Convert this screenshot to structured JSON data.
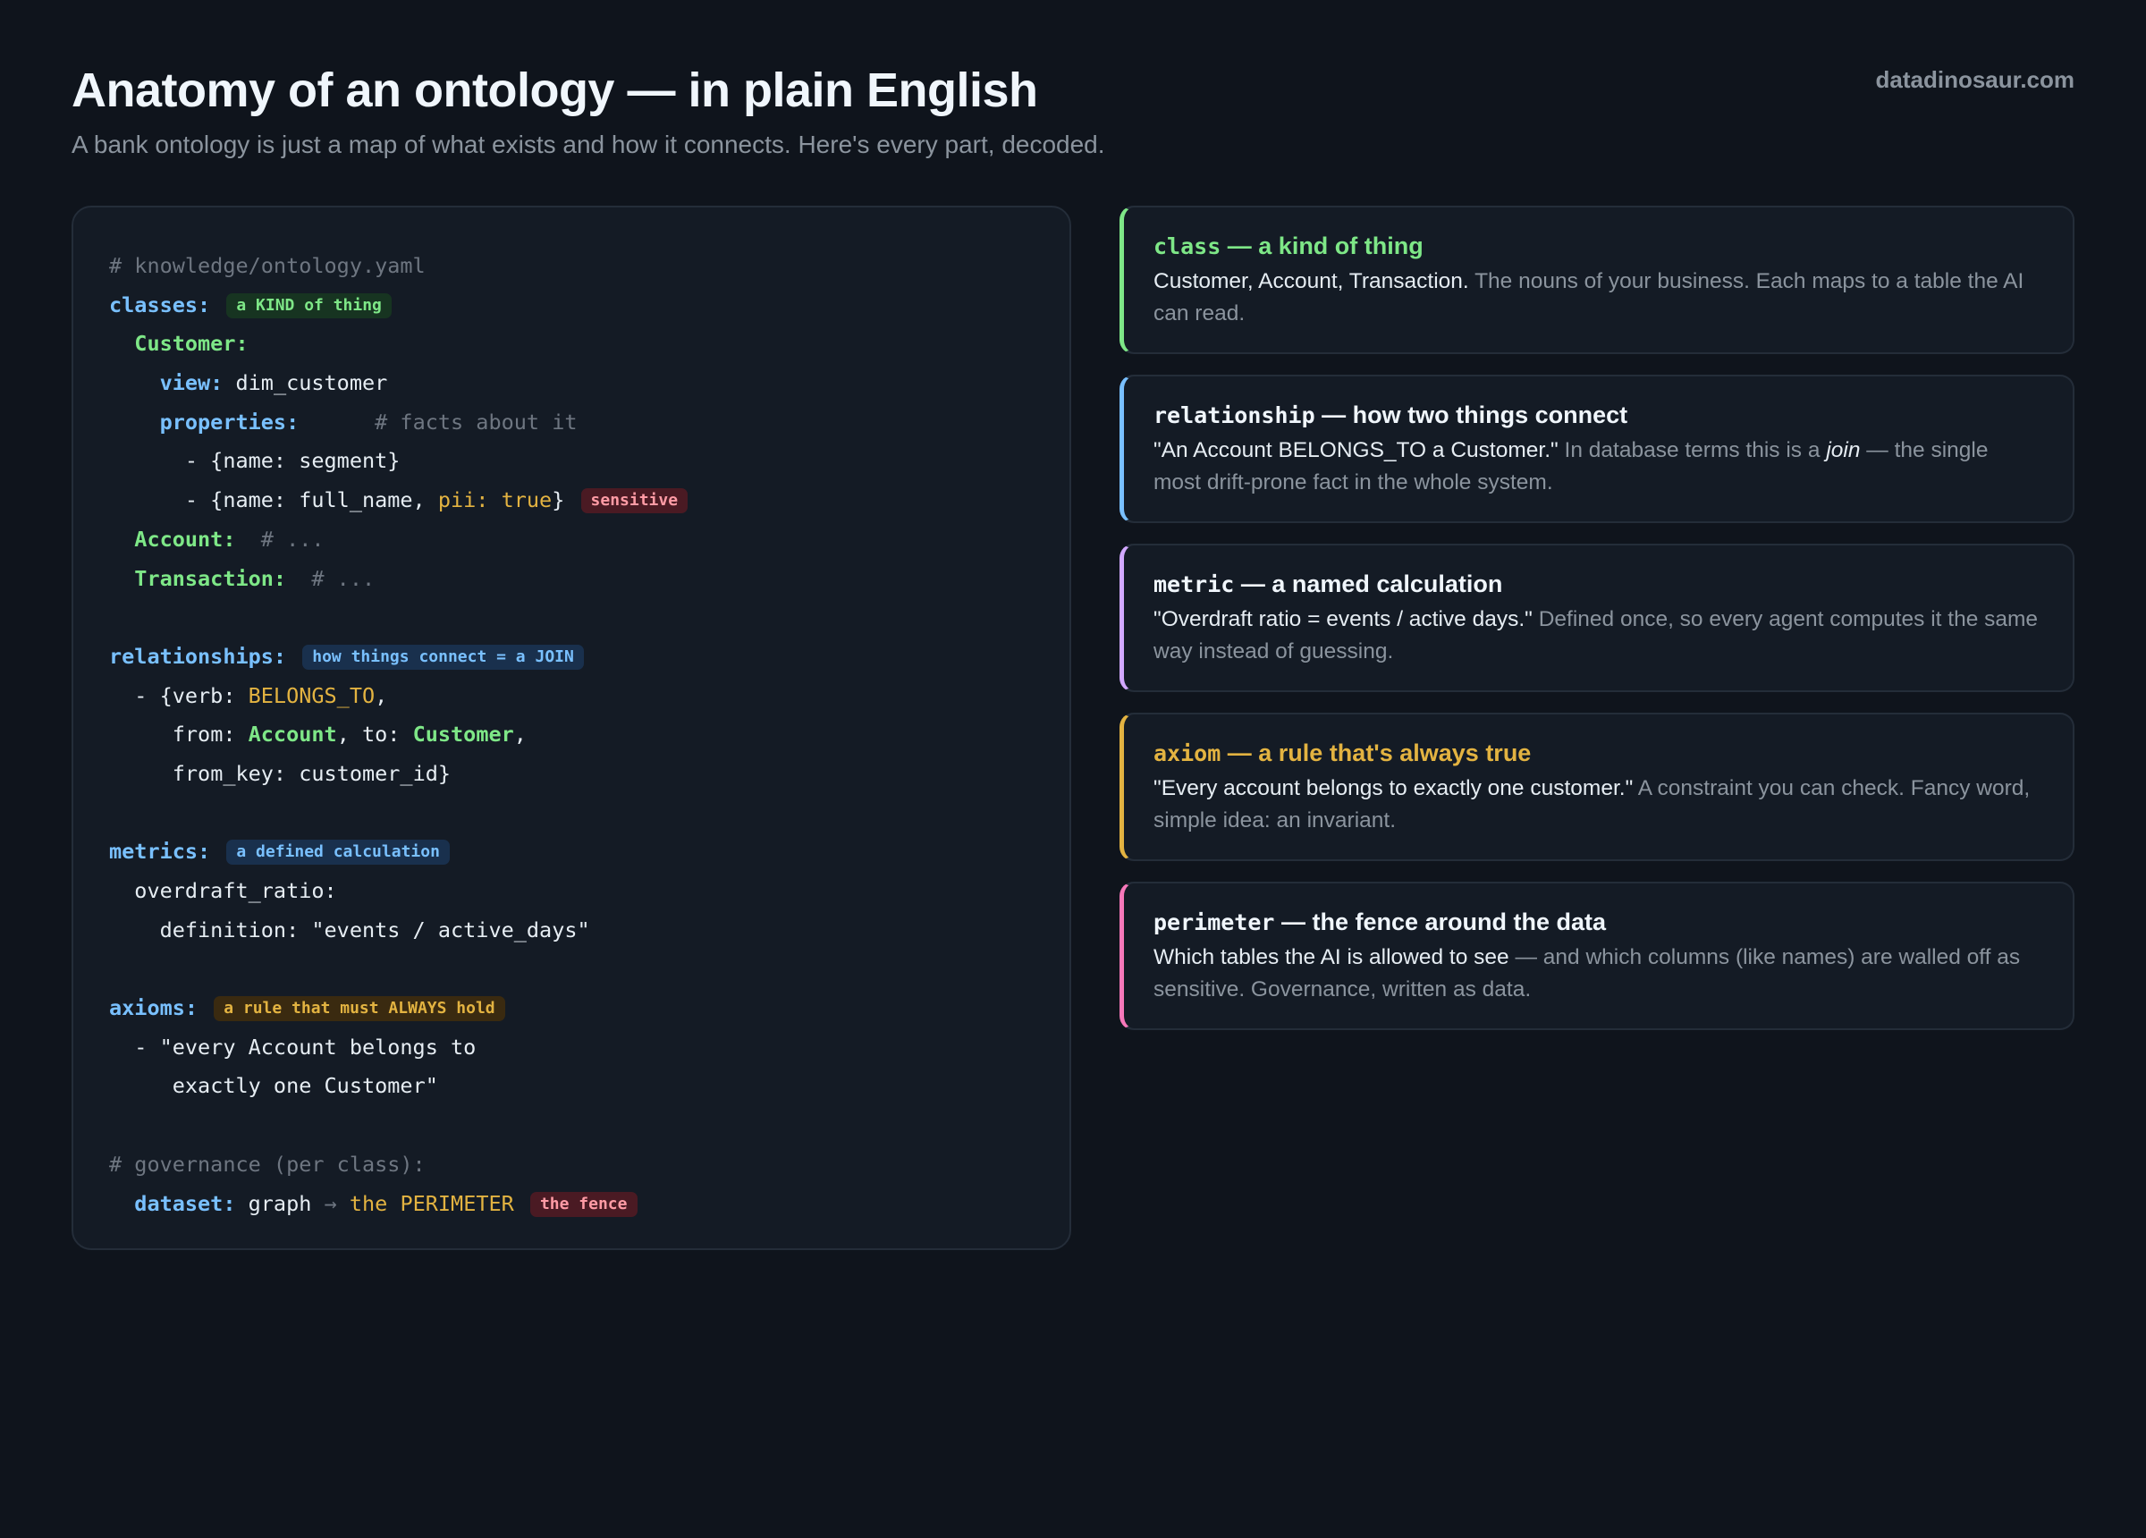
{
  "brand": "datadinosaur.com",
  "header": {
    "title": "Anatomy of an ontology — in plain English",
    "subtitle": "A bank ontology is just a map of what exists and how it connects. Here's every part, decoded."
  },
  "code": {
    "file_comment": "# knowledge/ontology.yaml",
    "classes_key": "classes:",
    "classes_pill": "a KIND of thing",
    "customer_key": "Customer:",
    "view_key": "view:",
    "view_value": "dim_customer",
    "properties_key": "properties:",
    "properties_comment": "# facts about it",
    "prop_segment": "- {name: segment}",
    "prop_fullname_start": "- {name: full_name, ",
    "prop_fullname_pii": "pii: true",
    "prop_fullname_end": "}",
    "sensitive_pill": "sensitive",
    "account_key": "Account:",
    "account_comment": "# ...",
    "transaction_key": "Transaction:",
    "transaction_comment": "# ...",
    "relationships_key": "relationships:",
    "relationships_pill": "how things connect = a JOIN",
    "rel_verb_start": "- {verb: ",
    "rel_verb_value": "BELONGS_TO",
    "rel_verb_end": ",",
    "rel_from_label": "from: ",
    "rel_from_value": "Account",
    "rel_to_label": ", to: ",
    "rel_to_value": "Customer",
    "rel_to_end": ",",
    "rel_fromkey": "from_key: customer_id}",
    "metrics_key": "metrics:",
    "metrics_pill": "a defined calculation",
    "metric_name": "overdraft_ratio:",
    "metric_definition": "definition: \"events / active_days\"",
    "axioms_key": "axioms:",
    "axioms_pill": "a rule that must ALWAYS hold",
    "axiom_line1": "- \"every Account belongs to",
    "axiom_line2": "exactly one Customer\"",
    "governance_comment": "# governance (per class):",
    "dataset_key": "dataset:",
    "dataset_graph": "graph",
    "dataset_arrow": "→",
    "dataset_value": "the PERIMETER",
    "fence_pill": "the fence"
  },
  "cards": [
    {
      "term": "class",
      "heading": "— a kind of thing",
      "lead": "Customer, Account, Transaction.",
      "body": "The nouns of your business. Each maps to a table the AI can read.",
      "accent": "#7ee787"
    },
    {
      "term": "relationship",
      "heading": "— how two things connect",
      "lead": "\"An Account BELONGS_TO a Customer.\"",
      "body_pre": "In database terms this is a",
      "body_em": "join",
      "body_post": "— the single most drift-prone fact in the whole system.",
      "accent": "#79c0ff"
    },
    {
      "term": "metric",
      "heading": "— a named calculation",
      "lead": "\"Overdraft ratio = events / active days.\"",
      "body": "Defined once, so every agent computes it the same way instead of guessing.",
      "accent": "#d2a8ff"
    },
    {
      "term": "axiom",
      "heading": "— a rule that's always true",
      "lead": "\"Every account belongs to exactly one customer.\"",
      "body": "A constraint you can check. Fancy word, simple idea: an invariant.",
      "accent": "#e3b341"
    },
    {
      "term": "perimeter",
      "heading": "— the fence around the data",
      "lead": "Which tables the AI is allowed to see",
      "body": "— and which columns (like names) are walled off as sensitive. Governance, written as data.",
      "accent": "#f778ba"
    }
  ]
}
